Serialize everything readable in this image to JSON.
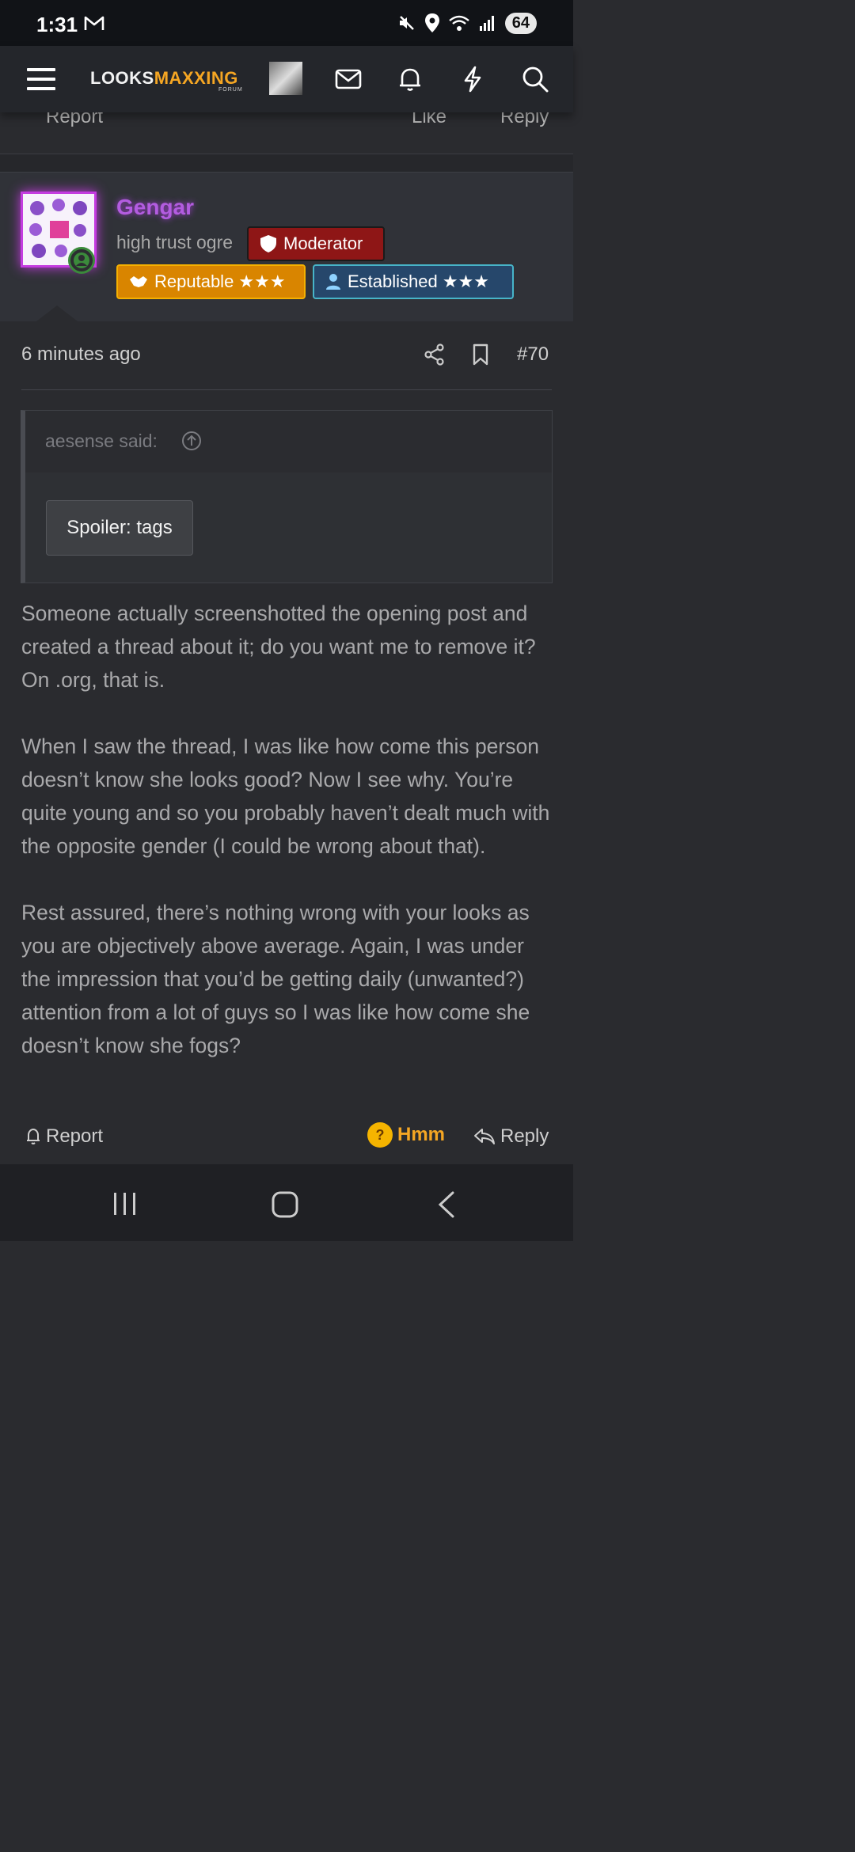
{
  "status_bar": {
    "time": "1:31",
    "battery": "64",
    "icons": [
      "gmail-icon",
      "mute-icon",
      "location-icon",
      "wifi-icon",
      "signal-icon"
    ]
  },
  "header": {
    "logo_looks": "LOOKS",
    "logo_maxxing": "MAXXING",
    "logo_sub": "FORUM",
    "icons": [
      "menu-icon",
      "avatar",
      "mail-icon",
      "bell-icon",
      "lightning-icon",
      "search-icon"
    ]
  },
  "prev_post": {
    "report": "Report",
    "like": "Like",
    "reply": "Reply"
  },
  "user": {
    "name": "Gengar",
    "title": "high trust ogre",
    "badges": {
      "moderator": "Moderator",
      "reputable": "Reputable ★★★",
      "established": "Established ★★★"
    }
  },
  "post": {
    "time": "6 minutes ago",
    "number": "#70",
    "quote": {
      "author": "aesense said:",
      "spoiler": "Spoiler: tags"
    },
    "paragraphs": [
      "Someone actually screenshotted the opening post and created a thread about it; do you want me to remove it? On .org, that is.",
      "When I saw the thread, I was like how come this person doesn’t know she looks good? Now I see why. You’re quite young and so you probably haven’t dealt much with the opposite gender (I could be wrong about that).",
      "Rest assured, there’s nothing wrong with your looks as you are objectively above average. Again, I was under the impression that you’d be getting daily (unwanted?) attention from a lot of guys so I was like how come she doesn’t know she fogs?"
    ],
    "actions": {
      "report": "Report",
      "reaction": "Hmm",
      "reply": "Reply"
    }
  },
  "colors": {
    "accent": "#f5a623",
    "username": "#b35ce0",
    "moderator": "#8e1616",
    "reputable": "#d98500",
    "established": "#26476b"
  }
}
